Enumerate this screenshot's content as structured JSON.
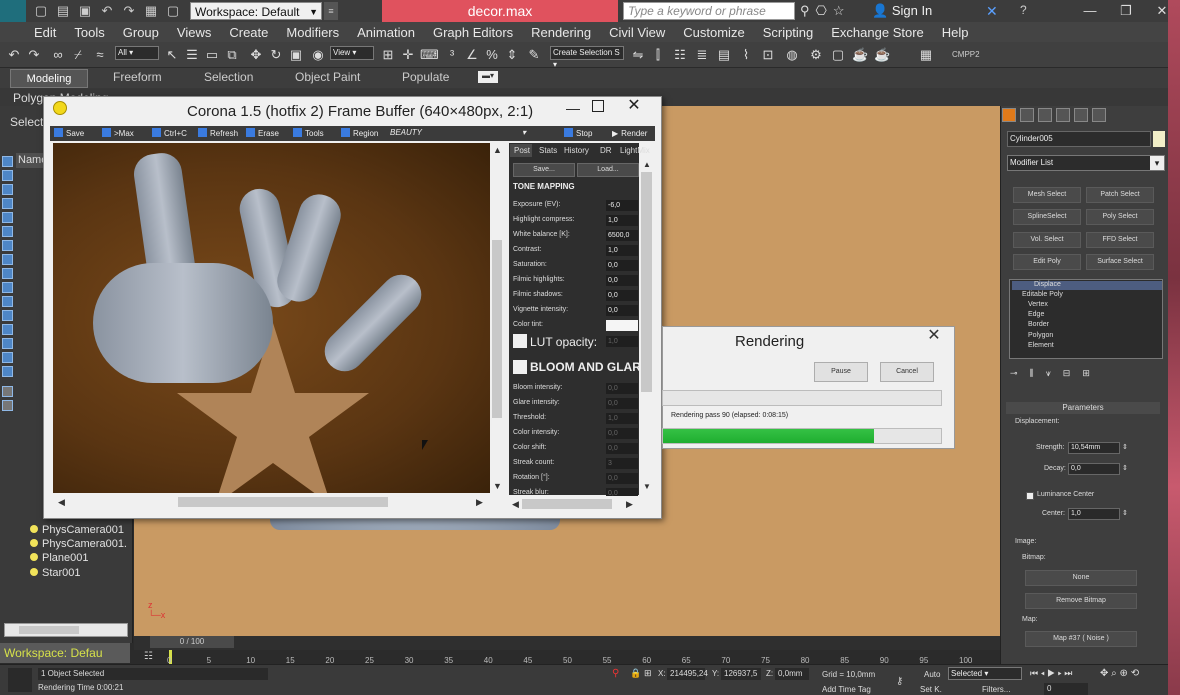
{
  "app": {
    "workspace": "Workspace: Default",
    "file_title": "decor.max",
    "search_placeholder": "Type a keyword or phrase",
    "sign_in": "Sign In"
  },
  "menu": [
    "Edit",
    "Tools",
    "Group",
    "Views",
    "Create",
    "Modifiers",
    "Animation",
    "Graph Editors",
    "Rendering",
    "Civil View",
    "Customize",
    "Scripting",
    "Exchange Store",
    "Help"
  ],
  "toolbar": {
    "filter_value": "All",
    "coord_value": "View",
    "selection_set": "Create Selection S",
    "cmpp": "CMPP2"
  },
  "ribbon": {
    "tabs": [
      "Modeling",
      "Freeform",
      "Selection",
      "Object Paint",
      "Populate"
    ],
    "sub_label": "Polygon Modeling"
  },
  "scene_explorer": {
    "select_label": "Select",
    "name_header": "Name",
    "objects": [
      "PhysCamera001",
      "PhysCamera001.",
      "Plane001",
      "Star001"
    ],
    "workspace_label": "Workspace: Defau"
  },
  "timeline": {
    "slider": "0 / 100",
    "ticks": [
      "0",
      "5",
      "10",
      "15",
      "20",
      "25",
      "30",
      "35",
      "40",
      "45",
      "50",
      "55",
      "60",
      "65",
      "70",
      "75",
      "80",
      "85",
      "90",
      "95",
      "100"
    ]
  },
  "status": {
    "objects_selected": "1 Object Selected",
    "render_time": "Rendering Time  0:00:21",
    "x_value": "214495,24",
    "y_value": "126937,5",
    "z_value": "0,0mm",
    "grid": "Grid = 10,0mm",
    "add_time_tag": "Add Time Tag",
    "auto": "Auto",
    "set_k": "Set K.",
    "selected": "Selected",
    "filters": "Filters...",
    "frame": "0"
  },
  "command_panel": {
    "object_name": "Cylinder005",
    "modifier_list": "Modifier List",
    "modifier_buttons": [
      "Mesh Select",
      "Patch Select",
      "SplineSelect",
      "Poly Select",
      "Vol. Select",
      "FFD Select",
      "Edit Poly",
      "Surface Select"
    ],
    "stack": [
      "Displace",
      "Editable Poly",
      "Vertex",
      "Edge",
      "Border",
      "Polygon",
      "Element"
    ],
    "parameters_title": "Parameters",
    "displacement_label": "Displacement:",
    "strength_label": "Strength:",
    "strength_value": "10,54mm",
    "decay_label": "Decay:",
    "decay_value": "0,0",
    "luminance_center": "Luminance Center",
    "center_label": "Center:",
    "center_value": "1,0",
    "image_label": "Image:",
    "bitmap_label": "Bitmap:",
    "bitmap_value": "None",
    "remove_bitmap": "Remove Bitmap",
    "map_label": "Map:",
    "map_value": "Map #37  ( Noise )"
  },
  "frame_buffer": {
    "title": "Corona 1.5 (hotfix 2) Frame Buffer (640×480px, 2:1)",
    "toolbar": [
      "Save",
      ">Max",
      "Ctrl+C",
      "Refresh",
      "Erase",
      "Tools",
      "Region"
    ],
    "channel": "BEAUTY",
    "stop": "Stop",
    "render": "Render",
    "panel_tabs": [
      "Post",
      "Stats",
      "History",
      "DR",
      "LightMix"
    ],
    "save_btn": "Save...",
    "load_btn": "Load...",
    "tone_mapping": "TONE MAPPING",
    "tone_params": [
      {
        "label": "Exposure (EV):",
        "value": "-6,0"
      },
      {
        "label": "Highlight compress:",
        "value": "1,0"
      },
      {
        "label": "White balance [K]:",
        "value": "6500,0"
      },
      {
        "label": "Contrast:",
        "value": "1,0"
      },
      {
        "label": "Saturation:",
        "value": "0,0"
      },
      {
        "label": "Filmic highlights:",
        "value": "0,0"
      },
      {
        "label": "Filmic shadows:",
        "value": "0,0"
      },
      {
        "label": "Vignette intensity:",
        "value": "0,0"
      },
      {
        "label": "Color tint:",
        "value": ""
      }
    ],
    "lut_label": "LUT opacity:",
    "lut_value": "1,0",
    "bloom_title": "BLOOM AND GLARE",
    "bloom_params": [
      {
        "label": "Bloom intensity:",
        "value": "0,0"
      },
      {
        "label": "Glare intensity:",
        "value": "0,0"
      },
      {
        "label": "Threshold:",
        "value": "1,0"
      },
      {
        "label": "Color intensity:",
        "value": "0,0"
      },
      {
        "label": "Color shift:",
        "value": "0,0"
      },
      {
        "label": "Streak count:",
        "value": "3"
      },
      {
        "label": "Rotation [°]:",
        "value": "0,0"
      },
      {
        "label": "Streak blur:",
        "value": "0,0"
      }
    ]
  },
  "rendering_dialog": {
    "title": "Rendering",
    "pause": "Pause",
    "cancel": "Cancel",
    "status": "Rendering pass 90 (elapsed: 0:08:15)",
    "progress": 0.76
  },
  "colors": {
    "title_highlight": "#e0525e",
    "progress_green": "#1fae30",
    "viewport_bg": "#c99a63"
  }
}
